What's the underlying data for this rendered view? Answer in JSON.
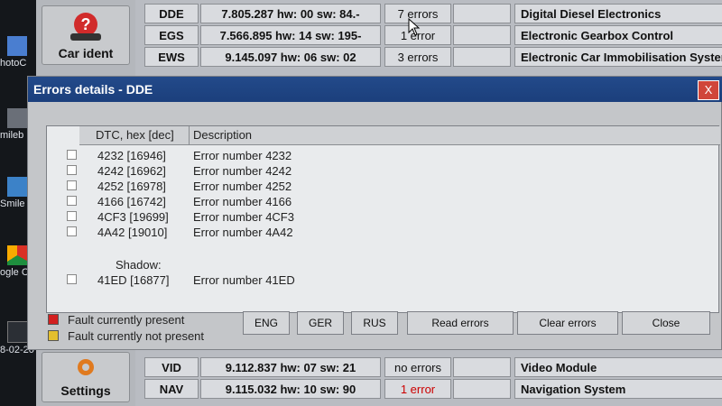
{
  "desktop": {
    "icons": [
      "hotoC",
      "mileb",
      "Smile",
      "ogle C",
      "8-02-20"
    ]
  },
  "sidebar": {
    "car_ident": "Car ident",
    "settings": "Settings"
  },
  "modules_top": [
    {
      "code": "DDE",
      "version": "7.805.287  hw: 00  sw: 84.-",
      "errors": "7 errors",
      "desc": "Digital Diesel Electronics"
    },
    {
      "code": "EGS",
      "version": "7.566.895  hw: 14  sw: 195-",
      "errors": "1 error",
      "desc": "Electronic Gearbox Control"
    },
    {
      "code": "EWS",
      "version": "9.145.097  hw: 06  sw: 02",
      "errors": "3 errors",
      "desc": "Electronic Car Immobilisation System"
    }
  ],
  "modules_bottom": [
    {
      "code": "VID",
      "version": "9.112.837  hw: 07  sw: 21",
      "errors": "no errors",
      "desc": "Video Module"
    },
    {
      "code": "NAV",
      "version": "9.115.032  hw: 10  sw: 90",
      "errors": "1 error",
      "desc": "Navigation System"
    }
  ],
  "dialog": {
    "title": "Errors details - DDE",
    "close": "X",
    "col_dtc": "DTC, hex [dec]",
    "col_desc": "Description",
    "rows": [
      {
        "dtc": "4232 [16946]",
        "desc": "Error number 4232"
      },
      {
        "dtc": "4242 [16962]",
        "desc": "Error number 4242"
      },
      {
        "dtc": "4252 [16978]",
        "desc": "Error number 4252"
      },
      {
        "dtc": "4166 [16742]",
        "desc": "Error number 4166"
      },
      {
        "dtc": "4CF3 [19699]",
        "desc": "Error number 4CF3"
      },
      {
        "dtc": "4A42 [19010]",
        "desc": "Error number 4A42"
      }
    ],
    "shadow_label": "Shadow:",
    "shadow_row": {
      "dtc": "41ED [16877]",
      "desc": "Error number 41ED"
    },
    "legend_present": "Fault currently present",
    "legend_not_present": "Fault currently not present",
    "color_present": "#d21f1f",
    "color_not_present": "#e3bf2f",
    "buttons": {
      "eng": "ENG",
      "ger": "GER",
      "rus": "RUS",
      "read": "Read errors",
      "clear": "Clear errors",
      "close": "Close"
    }
  }
}
